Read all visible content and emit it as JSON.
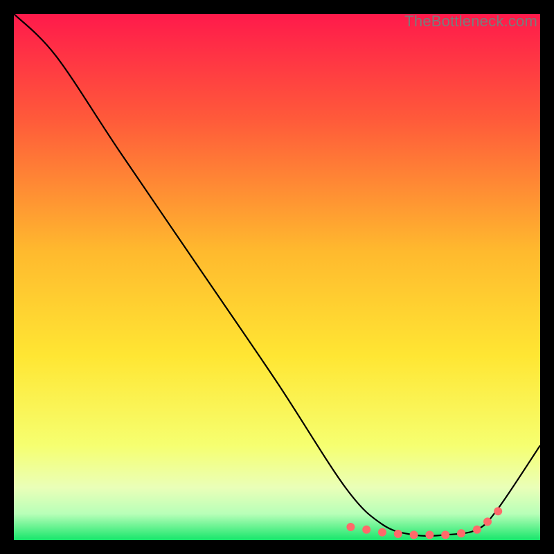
{
  "watermark": "TheBottleneck.com",
  "chart_data": {
    "type": "line",
    "title": "",
    "xlabel": "",
    "ylabel": "",
    "xlim": [
      0,
      100
    ],
    "ylim": [
      0,
      100
    ],
    "background_gradient": {
      "top": "#ff1a4b",
      "mid_upper": "#ff8a2a",
      "mid": "#ffe033",
      "mid_lower": "#f8ff66",
      "band_light": "#f0ffb0",
      "bottom": "#17e66b"
    },
    "series": [
      {
        "name": "bottleneck-curve",
        "color": "#000000",
        "x": [
          0,
          8,
          20,
          35,
          50,
          63,
          70,
          76,
          82,
          88,
          92,
          100
        ],
        "y": [
          100,
          92,
          74,
          52,
          30,
          10,
          3,
          1,
          1,
          2,
          6,
          18
        ]
      }
    ],
    "highlight_points": {
      "color": "#ff6a6a",
      "radius": 6,
      "x": [
        64,
        67,
        70,
        73,
        76,
        79,
        82,
        85,
        88,
        90,
        92
      ],
      "y": [
        2.5,
        2,
        1.5,
        1.2,
        1,
        1,
        1,
        1.3,
        2,
        3.5,
        5.5
      ]
    }
  }
}
